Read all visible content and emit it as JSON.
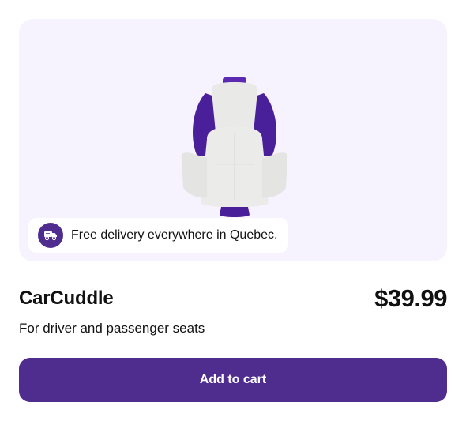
{
  "product": {
    "name": "CarCuddle",
    "price": "$39.99",
    "subtitle": "For driver and passenger seats",
    "image_icon": "car-seat-cushion-image"
  },
  "delivery": {
    "text": "Free delivery everywhere in Quebec.",
    "icon": "delivery-truck-icon"
  },
  "actions": {
    "add_to_cart_label": "Add to cart"
  },
  "colors": {
    "accent": "#4f2d8f",
    "panel_background": "#f7f3fe"
  }
}
